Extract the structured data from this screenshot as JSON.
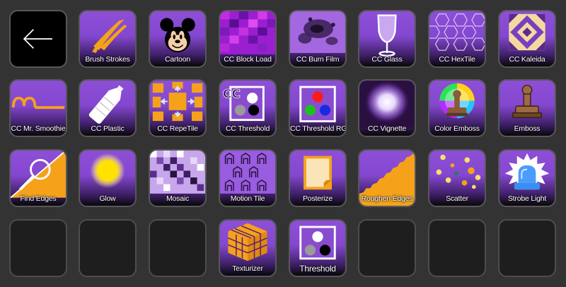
{
  "colors": {
    "background": "#333333",
    "key_purple": "#8d4fd6",
    "accent_orange": "#f5a21a"
  },
  "back_key": {
    "icon": "arrow-left-icon"
  },
  "keys": [
    {
      "label": "Brush Strokes",
      "icon": "brush-strokes-icon"
    },
    {
      "label": "Cartoon",
      "icon": "cartoon-mouse-icon"
    },
    {
      "label": "CC Block Load",
      "icon": "block-load-icon"
    },
    {
      "label": "CC Burn Film",
      "icon": "burn-film-icon"
    },
    {
      "label": "CC Glass",
      "icon": "wine-glass-icon"
    },
    {
      "label": "CC HexTile",
      "icon": "hex-tile-icon"
    },
    {
      "label": "CC Kaleida",
      "icon": "kaleidoscope-icon"
    },
    {
      "label": "CC Mr. Smoothie",
      "icon": "smoothie-curve-icon"
    },
    {
      "label": "CC Plastic",
      "icon": "plastic-bottle-icon"
    },
    {
      "label": "CC RepeTile",
      "icon": "repetile-icon"
    },
    {
      "label": "CC Threshold",
      "icon": "cc-threshold-icon"
    },
    {
      "label": "CC Threshold RGB",
      "icon": "threshold-rgb-icon"
    },
    {
      "label": "CC Vignette",
      "icon": "vignette-icon"
    },
    {
      "label": "Color Emboss",
      "icon": "color-emboss-stamp-icon"
    },
    {
      "label": "Emboss",
      "icon": "emboss-stamp-icon"
    },
    {
      "label": "Find Edges",
      "icon": "find-edges-magnifier-icon"
    },
    {
      "label": "Glow",
      "icon": "glow-sun-icon"
    },
    {
      "label": "Mosaic",
      "icon": "mosaic-icon"
    },
    {
      "label": "Motion Tile",
      "icon": "motion-tile-icon"
    },
    {
      "label": "Posterize",
      "icon": "posterize-icon"
    },
    {
      "label": "Roughen Edges",
      "icon": "roughen-edges-icon"
    },
    {
      "label": "Scatter",
      "icon": "scatter-dots-icon"
    },
    {
      "label": "Strobe Light",
      "icon": "strobe-light-icon"
    },
    {
      "label": "Texturizer",
      "icon": "texturizer-cube-icon"
    },
    {
      "label": "Threshold",
      "icon": "threshold-icon"
    }
  ]
}
